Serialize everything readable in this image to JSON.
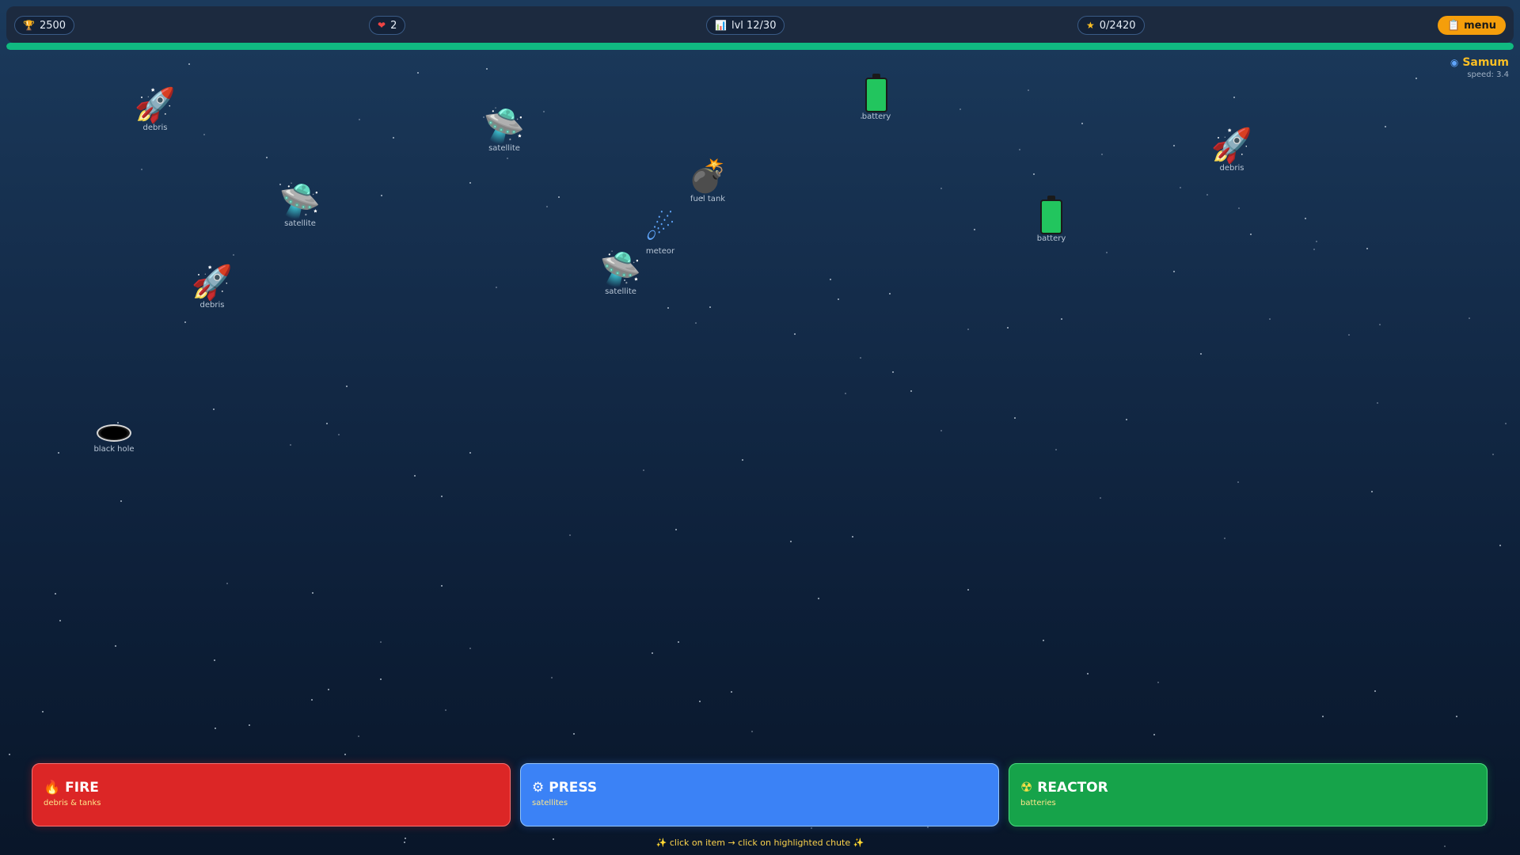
{
  "hud": {
    "score": {
      "icon": "trophy-icon",
      "glyph": "🏆",
      "value": "2500"
    },
    "lives": {
      "icon": "heart-icon",
      "glyph": "❤",
      "value": "2"
    },
    "level": {
      "icon": "chart-icon",
      "glyph": "📊",
      "value": "lvl 12/30"
    },
    "stars": {
      "icon": "star-icon",
      "glyph": "★",
      "value": "0/2420"
    },
    "menu": {
      "icon": "clipboard-icon",
      "glyph": "📋",
      "label": "menu"
    }
  },
  "progress": {
    "fraction": 1.0,
    "color": "#10b981"
  },
  "player": {
    "icon": "shield-icon",
    "glyph": "◉",
    "name": "Samum",
    "speed": "speed: 3.4"
  },
  "items": [
    {
      "kind": "rocket",
      "glyph": "🚀",
      "label": "debris"
    },
    {
      "kind": "ufo",
      "glyph": "🛸",
      "label": "satellite"
    },
    {
      "kind": "battery",
      "glyph": "",
      "label": "battery"
    },
    {
      "kind": "rocket",
      "glyph": "🚀",
      "label": "debris"
    },
    {
      "kind": "bomb",
      "glyph": "💣",
      "label": "fuel tank"
    },
    {
      "kind": "ufo",
      "glyph": "🛸",
      "label": "satellite"
    },
    {
      "kind": "battery",
      "glyph": "",
      "label": "battery"
    },
    {
      "kind": "comet",
      "glyph": "☄",
      "label": "meteor"
    },
    {
      "kind": "ufo",
      "glyph": "🛸",
      "label": "satellite"
    },
    {
      "kind": "rocket",
      "glyph": "🚀",
      "label": "debris"
    },
    {
      "kind": "hole",
      "glyph": "",
      "label": "black hole"
    }
  ],
  "chutes": [
    {
      "id": "fire",
      "icon": "flame-icon",
      "glyph": "🔥",
      "title": "FIRE",
      "subtitle": "debris & tanks",
      "color": "#dc2626"
    },
    {
      "id": "press",
      "icon": "gear-icon",
      "glyph": "⚙",
      "title": "PRESS",
      "subtitle": "satellites",
      "color": "#3b82f6"
    },
    {
      "id": "reactor",
      "icon": "radioactive-icon",
      "glyph": "☢",
      "title": "REACTOR",
      "subtitle": "batteries",
      "color": "#16a34a"
    }
  ],
  "hint": "✨ click on item → click on highlighted chute ✨"
}
